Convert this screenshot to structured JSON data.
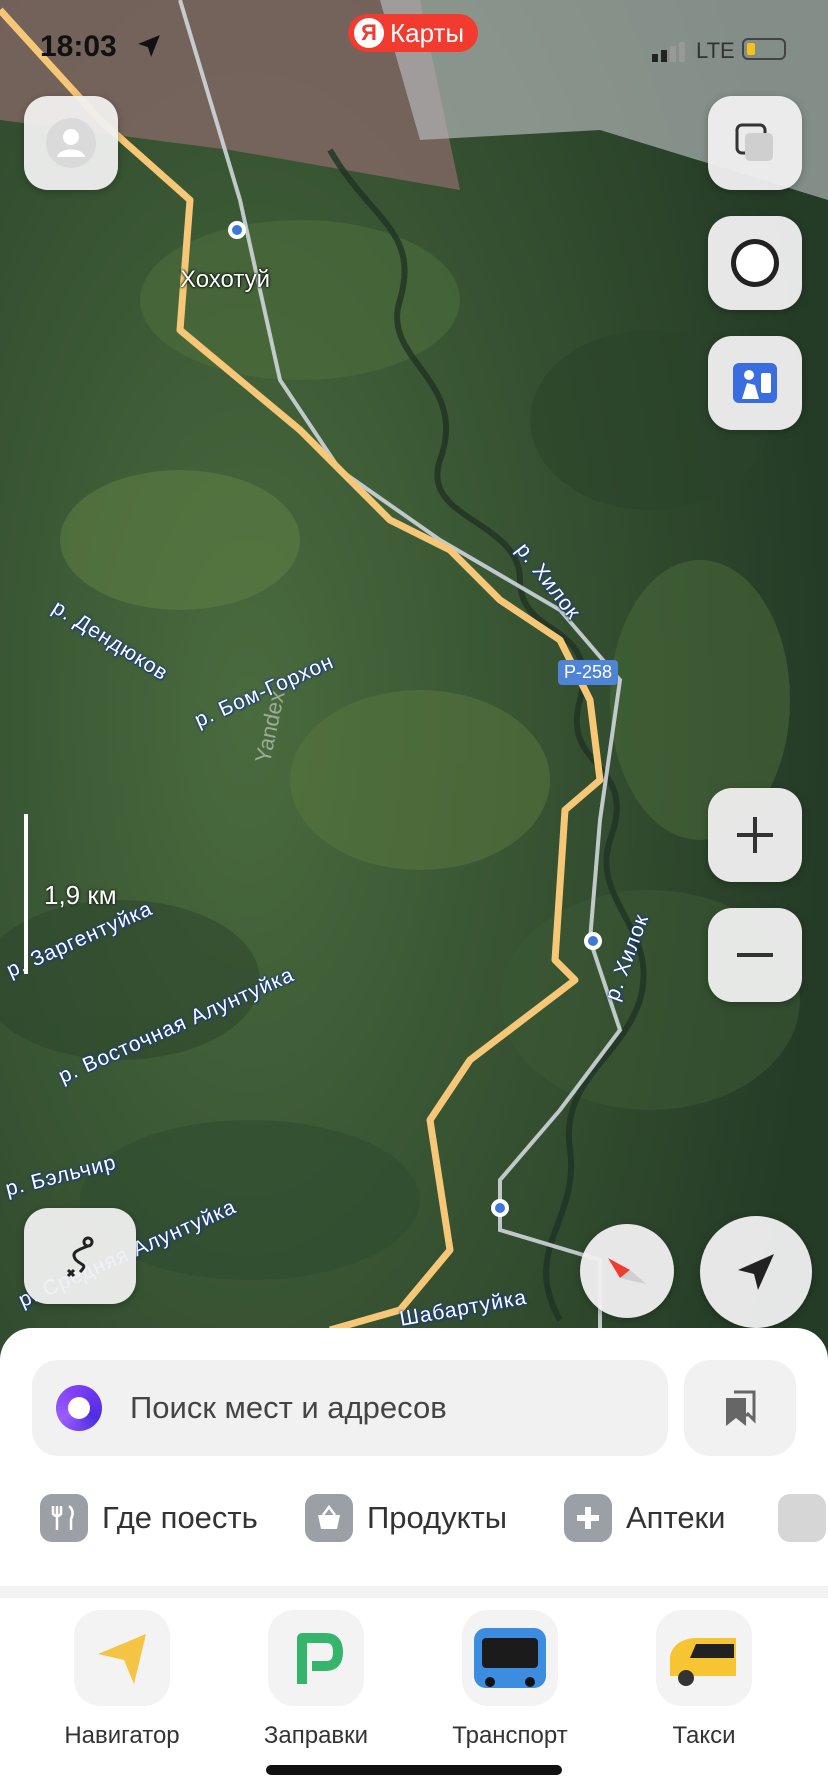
{
  "status_bar": {
    "time": "18:03",
    "network": "LTE",
    "battery_level": 0.15
  },
  "brand": {
    "logo_letter": "Я",
    "name": "Карты"
  },
  "map": {
    "town_label": "Хохотуй",
    "road_badge": "Р-258",
    "scale_label": "1,9 км",
    "watermark": "Yandex",
    "rivers": [
      "р. Дендюков",
      "р. Бом-Горхон",
      "р. Хилок",
      "р. Заргентуйка",
      "р. Восточная Алунтуйка",
      "р. Хилок",
      "р. Бэльчир",
      "р. Средняя Алунтуйка",
      "Шабартуйка"
    ]
  },
  "controls": {
    "zoom_in": "+",
    "zoom_out": "−"
  },
  "sheet": {
    "search_placeholder": "Поиск мест и адресов",
    "categories": [
      {
        "label": "Где поесть",
        "icon": "fork-knife-icon"
      },
      {
        "label": "Продукты",
        "icon": "basket-icon"
      },
      {
        "label": "Аптеки",
        "icon": "plus-icon"
      }
    ],
    "dock": [
      {
        "label": "Навигатор",
        "icon": "navigator-icon"
      },
      {
        "label": "Заправки",
        "icon": "fuel-icon"
      },
      {
        "label": "Транспорт",
        "icon": "bus-icon"
      },
      {
        "label": "Такси",
        "icon": "taxi-icon"
      }
    ]
  },
  "colors": {
    "brand_red": "#f23a2f",
    "route_orange": "#f6c777",
    "alice_purple": "#7a3cf5"
  }
}
